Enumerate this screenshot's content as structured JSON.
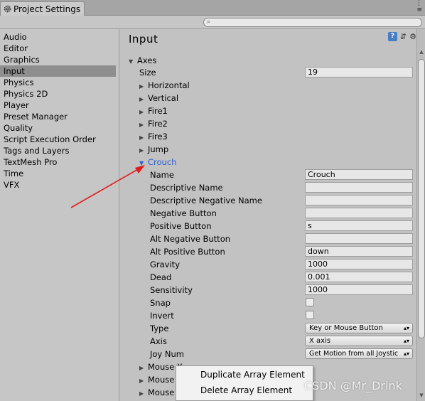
{
  "window": {
    "tab_title": "Project Settings",
    "tab_icon": "gear-icon",
    "search_placeholder": "",
    "controls": "⋮ ≡"
  },
  "sidebar": {
    "selected": "Input",
    "items": [
      {
        "label": "Audio"
      },
      {
        "label": "Editor"
      },
      {
        "label": "Graphics"
      },
      {
        "label": "Input"
      },
      {
        "label": "Physics"
      },
      {
        "label": "Physics 2D"
      },
      {
        "label": "Player"
      },
      {
        "label": "Preset Manager"
      },
      {
        "label": "Quality"
      },
      {
        "label": "Script Execution Order"
      },
      {
        "label": "Tags and Layers"
      },
      {
        "label": "TextMesh Pro"
      },
      {
        "label": "Time"
      },
      {
        "label": "VFX"
      }
    ]
  },
  "main": {
    "title": "Input",
    "axes_label": "Axes",
    "size_label": "Size",
    "size_value": "19",
    "collapsed_axes": [
      "Horizontal",
      "Vertical",
      "Fire1",
      "Fire2",
      "Fire3",
      "Jump"
    ],
    "expanded_axis": {
      "label": "Crouch",
      "color": "#2a5fd6",
      "fields": {
        "name": {
          "label": "Name",
          "value": "Crouch"
        },
        "descriptive_name": {
          "label": "Descriptive Name",
          "value": ""
        },
        "descriptive_negative_name": {
          "label": "Descriptive Negative Name",
          "value": ""
        },
        "negative_button": {
          "label": "Negative Button",
          "value": ""
        },
        "positive_button": {
          "label": "Positive Button",
          "value": "s"
        },
        "alt_negative_button": {
          "label": "Alt Negative Button",
          "value": ""
        },
        "alt_positive_button": {
          "label": "Alt Positive Button",
          "value": "down"
        },
        "gravity": {
          "label": "Gravity",
          "value": "1000"
        },
        "dead": {
          "label": "Dead",
          "value": "0.001"
        },
        "sensitivity": {
          "label": "Sensitivity",
          "value": "1000"
        },
        "snap": {
          "label": "Snap",
          "checked": false
        },
        "invert": {
          "label": "Invert",
          "checked": false
        },
        "type": {
          "label": "Type",
          "value": "Key or Mouse Button"
        },
        "axis": {
          "label": "Axis",
          "value": "X axis"
        },
        "joy_num": {
          "label": "Joy Num",
          "value": "Get Motion from all Joystic"
        }
      }
    },
    "trailing_axes": [
      "Mouse X",
      "Mouse",
      "Mouse"
    ]
  },
  "context_menu": {
    "items": [
      "Duplicate Array Element",
      "Delete Array Element"
    ]
  },
  "watermark": "CSDN @Mr_Drink",
  "annotation": {
    "arrow_color": "#e31b1b"
  }
}
